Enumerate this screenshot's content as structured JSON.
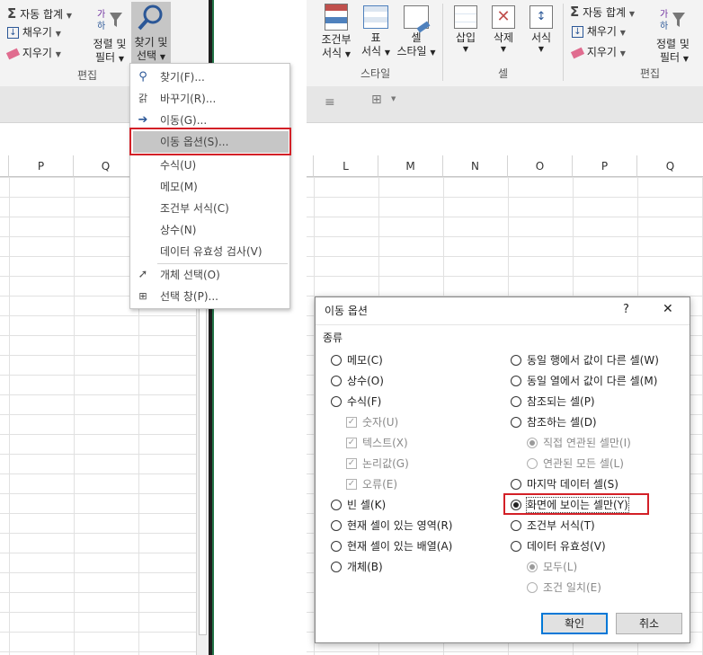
{
  "left_ribbon": {
    "autosum": "자동 합계",
    "fill": "채우기",
    "clear": "지우기",
    "sort_filter_1": "정렬 및",
    "sort_filter_2": "필터",
    "find_select_1": "찾기 및",
    "find_select_2": "선택",
    "group_label": "편집"
  },
  "right_ribbon": {
    "cond_format_1": "조건부",
    "cond_format_2": "서식",
    "table_1": "표",
    "table_2": "서식",
    "cell_style_1": "셀",
    "cell_style_2": "스타일",
    "insert": "삽입",
    "delete": "삭제",
    "format": "서식",
    "autosum": "자동 합계",
    "fill": "채우기",
    "clear": "지우기",
    "sort_filter_1": "정렬 및",
    "sort_filter_2": "필터",
    "group_style": "스타일",
    "group_cells": "셀",
    "group_edit": "편집"
  },
  "left_columns": [
    "P",
    "Q"
  ],
  "right_columns": [
    "L",
    "M",
    "N",
    "O",
    "P",
    "Q"
  ],
  "menu": {
    "items": [
      {
        "label": "찾기(F)...",
        "icon": "search-icon"
      },
      {
        "label": "바꾸기(R)...",
        "icon": "replace-icon"
      },
      {
        "label": "이동(G)...",
        "icon": "arrow-right-icon"
      },
      {
        "label": "이동 옵션(S)...",
        "icon": ""
      },
      {
        "label": "수식(U)",
        "icon": ""
      },
      {
        "label": "메모(M)",
        "icon": ""
      },
      {
        "label": "조건부 서식(C)",
        "icon": ""
      },
      {
        "label": "상수(N)",
        "icon": ""
      },
      {
        "label": "데이터 유효성 검사(V)",
        "icon": ""
      },
      {
        "label": "개체 선택(O)",
        "icon": "cursor-icon"
      },
      {
        "label": "선택 창(P)...",
        "icon": "selection-pane-icon"
      }
    ],
    "highlighted_index": 3
  },
  "dialog": {
    "title": "이동 옵션",
    "help": "?",
    "close": "✕",
    "section": "종류",
    "left_options": [
      {
        "label": "메모(C)",
        "kind": "radio",
        "checked": false,
        "disabled": false
      },
      {
        "label": "상수(O)",
        "kind": "radio",
        "checked": false,
        "disabled": false
      },
      {
        "label": "수식(F)",
        "kind": "radio",
        "checked": false,
        "disabled": false
      },
      {
        "label": "숫자(U)",
        "kind": "check",
        "checked": true,
        "disabled": true
      },
      {
        "label": "텍스트(X)",
        "kind": "check",
        "checked": true,
        "disabled": true
      },
      {
        "label": "논리값(G)",
        "kind": "check",
        "checked": true,
        "disabled": true
      },
      {
        "label": "오류(E)",
        "kind": "check",
        "checked": true,
        "disabled": true
      },
      {
        "label": "빈 셀(K)",
        "kind": "radio",
        "checked": false,
        "disabled": false
      },
      {
        "label": "현재 셀이 있는 영역(R)",
        "kind": "radio",
        "checked": false,
        "disabled": false
      },
      {
        "label": "현재 셀이 있는 배열(A)",
        "kind": "radio",
        "checked": false,
        "disabled": false
      },
      {
        "label": "개체(B)",
        "kind": "radio",
        "checked": false,
        "disabled": false
      }
    ],
    "right_options": [
      {
        "label": "동일 행에서 값이 다른 셀(W)",
        "kind": "radio",
        "checked": false,
        "disabled": false
      },
      {
        "label": "동일 열에서 값이 다른 셀(M)",
        "kind": "radio",
        "checked": false,
        "disabled": false
      },
      {
        "label": "참조되는 셀(P)",
        "kind": "radio",
        "checked": false,
        "disabled": false
      },
      {
        "label": "참조하는 셀(D)",
        "kind": "radio",
        "checked": false,
        "disabled": false
      },
      {
        "label": "직접 연관된 셀만(I)",
        "kind": "radio",
        "checked": true,
        "disabled": true
      },
      {
        "label": "연관된 모든 셀(L)",
        "kind": "radio",
        "checked": false,
        "disabled": true
      },
      {
        "label": "마지막 데이터 셀(S)",
        "kind": "radio",
        "checked": false,
        "disabled": false
      },
      {
        "label": "화면에 보이는 셀만(Y)",
        "kind": "radio",
        "checked": true,
        "disabled": false
      },
      {
        "label": "조건부 서식(T)",
        "kind": "radio",
        "checked": false,
        "disabled": false
      },
      {
        "label": "데이터 유효성(V)",
        "kind": "radio",
        "checked": false,
        "disabled": false
      },
      {
        "label": "모두(L)",
        "kind": "radio",
        "checked": true,
        "disabled": true
      },
      {
        "label": "조건 일치(E)",
        "kind": "radio",
        "checked": false,
        "disabled": true
      }
    ],
    "ok": "확인",
    "cancel": "취소"
  }
}
